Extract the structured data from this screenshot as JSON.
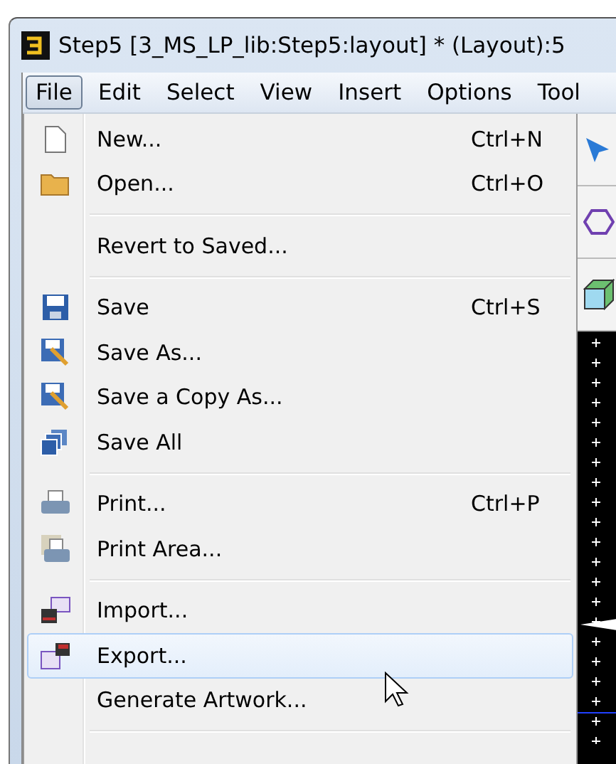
{
  "window": {
    "title": "Step5 [3_MS_LP_lib:Step5:layout] * (Layout):5"
  },
  "menu_bar": [
    {
      "label": "File",
      "selected": true
    },
    {
      "label": "Edit",
      "selected": false
    },
    {
      "label": "Select",
      "selected": false
    },
    {
      "label": "View",
      "selected": false
    },
    {
      "label": "Insert",
      "selected": false
    },
    {
      "label": "Options",
      "selected": false
    },
    {
      "label": "Tool",
      "selected": false
    }
  ],
  "file_menu": [
    {
      "kind": "item",
      "label": "New...",
      "shortcut": "Ctrl+N",
      "highlighted": false
    },
    {
      "kind": "item",
      "label": "Open...",
      "shortcut": "Ctrl+O",
      "highlighted": false
    },
    {
      "kind": "separator"
    },
    {
      "kind": "item",
      "label": "Revert to Saved...",
      "highlighted": false
    },
    {
      "kind": "separator"
    },
    {
      "kind": "item",
      "label": "Save",
      "shortcut": "Ctrl+S",
      "highlighted": false
    },
    {
      "kind": "item",
      "label": "Save As...",
      "highlighted": false
    },
    {
      "kind": "item",
      "label": "Save a Copy As...",
      "highlighted": false
    },
    {
      "kind": "item",
      "label": "Save All",
      "highlighted": false
    },
    {
      "kind": "separator"
    },
    {
      "kind": "item",
      "label": "Print...",
      "shortcut": "Ctrl+P",
      "highlighted": false
    },
    {
      "kind": "item",
      "label": "Print Area...",
      "highlighted": false
    },
    {
      "kind": "separator"
    },
    {
      "kind": "item",
      "label": "Import...",
      "highlighted": false
    },
    {
      "kind": "item",
      "label": "Export...",
      "highlighted": true
    },
    {
      "kind": "item",
      "label": "Generate Artwork...",
      "highlighted": false
    },
    {
      "kind": "separator"
    }
  ]
}
